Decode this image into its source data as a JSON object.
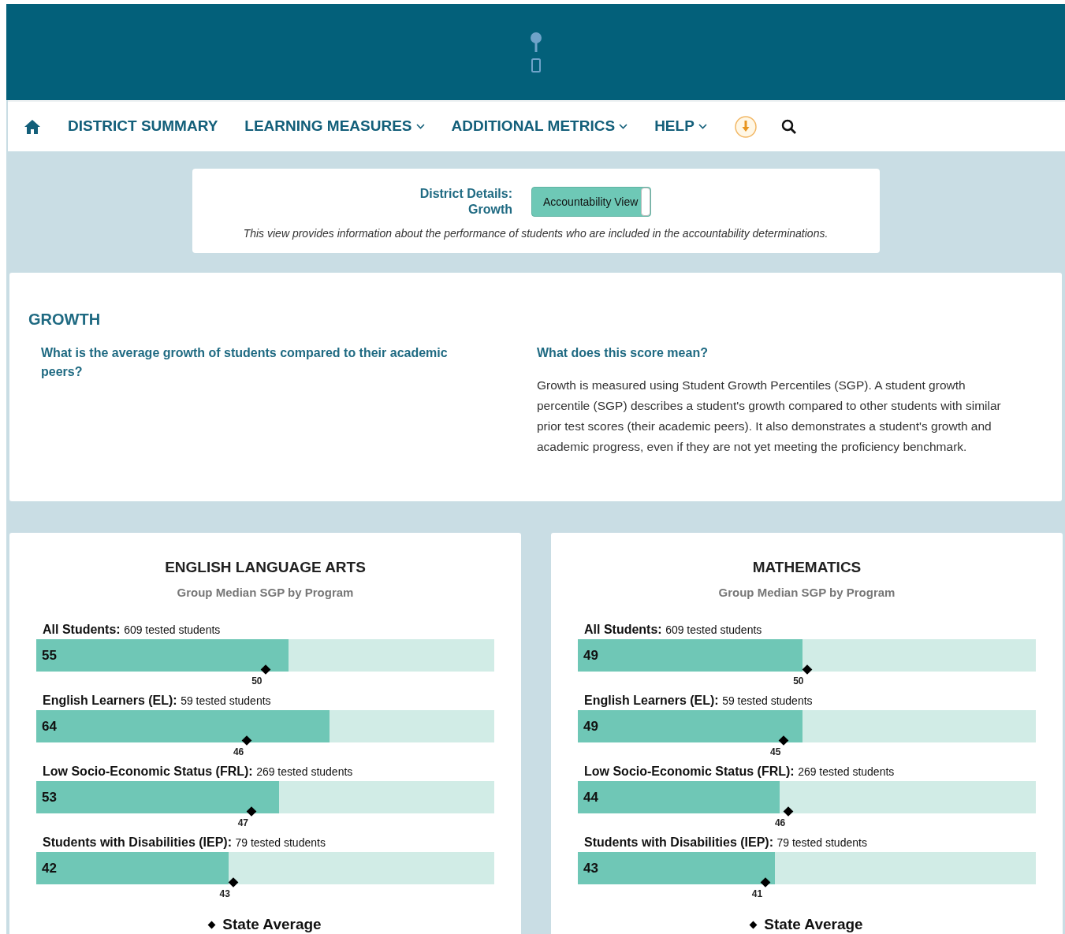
{
  "nav": {
    "items": [
      {
        "label": "DISTRICT SUMMARY",
        "dropdown": false
      },
      {
        "label": "LEARNING MEASURES",
        "dropdown": true
      },
      {
        "label": "ADDITIONAL METRICS",
        "dropdown": true
      },
      {
        "label": "HELP",
        "dropdown": true
      }
    ]
  },
  "details": {
    "title": "District Details:",
    "subtitle": "Growth",
    "toggle": {
      "label": "Accountability View",
      "on": true
    },
    "note": "This view provides information about the performance of students who are included in the accountability determinations."
  },
  "growth": {
    "heading": "GROWTH",
    "question": "What is the average growth of students compared to their academic peers?",
    "explain_title": "What does this score mean?",
    "explain_text": "Growth is measured using Student Growth Percentiles (SGP). A student growth percentile (SGP) describes a student's growth compared to other students with similar prior test scores (their academic peers). It also demonstrates a student's growth and academic progress, even if they are not yet meeting the proficiency benchmark."
  },
  "panels": [
    {
      "title": "ENGLISH LANGUAGE ARTS",
      "subtitle": "Group Median SGP by Program",
      "legend": "State Average",
      "rows": [
        {
          "group": "All Students:",
          "count": "609 tested students",
          "value": "55",
          "level": 0.55,
          "state_average": {
            "value": "50",
            "level": 0.5
          }
        },
        {
          "group": "English Learners (EL):",
          "count": "59 tested students",
          "value": "64",
          "level": 0.64,
          "state_average": {
            "value": "46",
            "level": 0.46
          }
        },
        {
          "group": "Low Socio-Economic Status (FRL):",
          "count": "269 tested students",
          "value": "53",
          "level": 0.53,
          "state_average": {
            "value": "47",
            "level": 0.47
          }
        },
        {
          "group": "Students with Disabilities (IEP):",
          "count": "79 tested students",
          "value": "42",
          "level": 0.42,
          "state_average": {
            "value": "43",
            "level": 0.43
          }
        }
      ]
    },
    {
      "title": "MATHEMATICS",
      "subtitle": "Group Median SGP by Program",
      "legend": "State Average",
      "rows": [
        {
          "group": "All Students:",
          "count": "609 tested students",
          "value": "49",
          "level": 0.49,
          "state_average": {
            "value": "50",
            "level": 0.5
          }
        },
        {
          "group": "English Learners (EL):",
          "count": "59 tested students",
          "value": "49",
          "level": 0.49,
          "state_average": {
            "value": "45",
            "level": 0.45
          }
        },
        {
          "group": "Low Socio-Economic Status (FRL):",
          "count": "269 tested students",
          "value": "44",
          "level": 0.44,
          "state_average": {
            "value": "46",
            "level": 0.46
          }
        },
        {
          "group": "Students with Disabilities (IEP):",
          "count": "79 tested students",
          "value": "43",
          "level": 0.43,
          "state_average": {
            "value": "41",
            "level": 0.41
          }
        }
      ]
    }
  ]
}
